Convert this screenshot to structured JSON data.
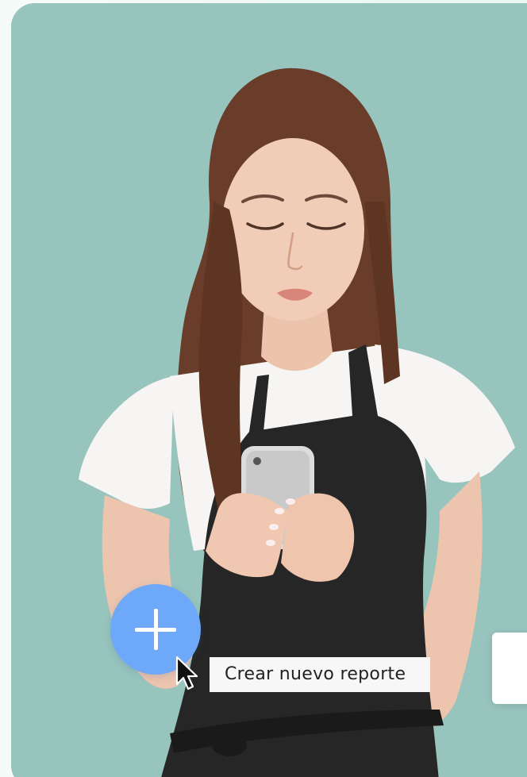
{
  "photo": {
    "description_icon": "person-with-phone-photo"
  },
  "actions": {
    "add_icon": "plus-icon",
    "tooltip_text": "Crear nuevo reporte"
  },
  "colors": {
    "background": "#98c4be",
    "accent_button": "#6ea8f8",
    "tooltip_bg": "#f7f7f7"
  }
}
